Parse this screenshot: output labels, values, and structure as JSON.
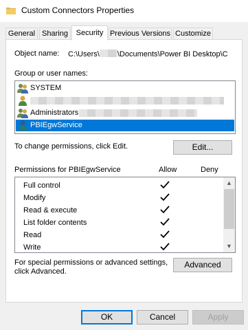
{
  "window": {
    "title": "Custom Connectors Properties",
    "icon": "folder-icon"
  },
  "tabs": [
    {
      "label": "General",
      "active": false
    },
    {
      "label": "Sharing",
      "active": false
    },
    {
      "label": "Security",
      "active": true
    },
    {
      "label": "Previous Versions",
      "active": false
    },
    {
      "label": "Customize",
      "active": false
    }
  ],
  "security": {
    "object_name_label": "Object name:",
    "object_path_prefix": "C:\\Users\\",
    "object_path_suffix": "\\Documents\\Power BI Desktop\\C",
    "group_label": "Group or user names:",
    "users": [
      {
        "name": "SYSTEM",
        "icon": "users-group-icon",
        "selected": false
      },
      {
        "name": "",
        "icon": "user-icon",
        "selected": false
      },
      {
        "name": "Administrators",
        "icon": "users-group-icon",
        "selected": false
      },
      {
        "name": "PBIEgwService",
        "icon": "user-icon",
        "selected": true
      }
    ],
    "change_text": "To change permissions, click Edit.",
    "edit_button": "Edit...",
    "permissions_label": "Permissions for PBIEgwService",
    "allow_header": "Allow",
    "deny_header": "Deny",
    "permissions": [
      {
        "name": "Full control",
        "allow": true,
        "deny": false
      },
      {
        "name": "Modify",
        "allow": true,
        "deny": false
      },
      {
        "name": "Read & execute",
        "allow": true,
        "deny": false
      },
      {
        "name": "List folder contents",
        "allow": true,
        "deny": false
      },
      {
        "name": "Read",
        "allow": true,
        "deny": false
      },
      {
        "name": "Write",
        "allow": true,
        "deny": false
      }
    ],
    "special_text_line1": "For special permissions or advanced settings,",
    "special_text_line2": "click Advanced.",
    "advanced_button": "Advanced"
  },
  "footer": {
    "ok": "OK",
    "cancel": "Cancel",
    "apply": "Apply"
  },
  "colors": {
    "selection": "#0078d7",
    "window_bg": "#f0f0f0"
  }
}
